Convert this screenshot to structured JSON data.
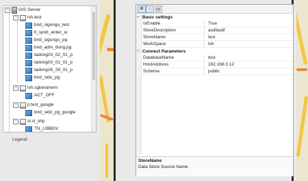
{
  "tree": {
    "root": "GIS Server",
    "nodes": [
      {
        "label": "lsh.test",
        "kind": "store"
      },
      {
        "label": "bnd_sigungu_test",
        "kind": "layer"
      },
      {
        "label": "lt_spsb_antec_w",
        "kind": "layer"
      },
      {
        "label": "bnd_sigungu_pg",
        "kind": "layer"
      },
      {
        "label": "bnd_adm_dong.pg",
        "kind": "layer"
      },
      {
        "label": "tadong03_02_01_p",
        "kind": "layer"
      },
      {
        "label": "tadong03_01_01_p",
        "kind": "layer"
      },
      {
        "label": "tadong26_29_01_p",
        "kind": "layer"
      },
      {
        "label": "bnd_sido_pg",
        "kind": "layer"
      },
      {
        "label": "lsh.sgboranemi",
        "kind": "store"
      },
      {
        "label": "ACT_OFF",
        "kind": "layer"
      },
      {
        "label": "jr.test_google",
        "kind": "store"
      },
      {
        "label": "bnd_sido_pg_google",
        "kind": "layer"
      },
      {
        "label": "si.sl_shp",
        "kind": "store"
      },
      {
        "label": "TN_LIBBDV",
        "kind": "layer"
      }
    ]
  },
  "legend_label": "Legend",
  "toolbar": {
    "categorized": "⊞",
    "alpha": "↓",
    "pages": "▭"
  },
  "properties": {
    "categories": [
      {
        "name": "Basic settings",
        "toggle": "−",
        "rows": [
          {
            "name": "IsEnable",
            "value": "True"
          },
          {
            "name": "StoreDescription",
            "value": "asdfasdf"
          },
          {
            "name": "StoreName",
            "value": "test"
          },
          {
            "name": "WorkSpace",
            "value": "lsh"
          }
        ]
      },
      {
        "name": "Connect Parameters",
        "toggle": "−",
        "rows": [
          {
            "name": "DatabaseName",
            "value": "test"
          },
          {
            "name": "HostAddress",
            "value": "192.168.0.12"
          },
          {
            "name": "Schema",
            "value": "public"
          }
        ]
      }
    ]
  },
  "description": {
    "title": "StoreName",
    "text": "Data Store Source Name"
  }
}
